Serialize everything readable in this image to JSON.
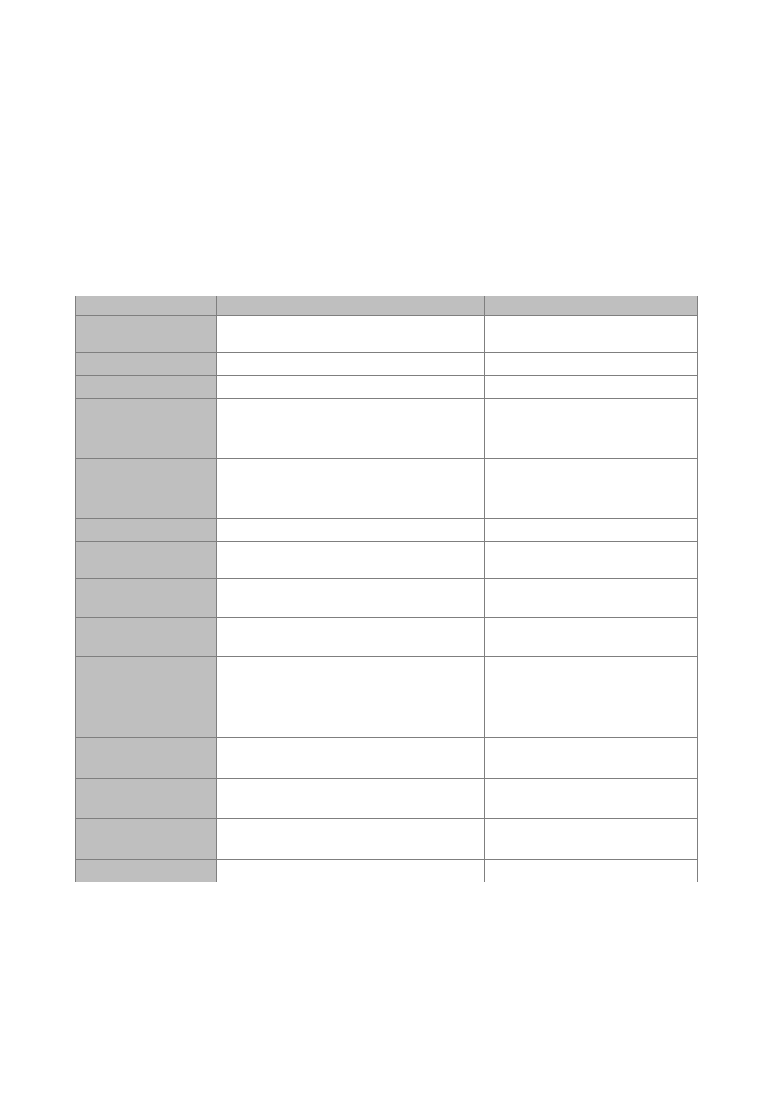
{
  "table": {
    "headers": [
      "",
      "",
      ""
    ],
    "rows": [
      {
        "height": "h-46",
        "cells": [
          "",
          "",
          ""
        ]
      },
      {
        "height": "h-28",
        "cells": [
          "",
          "",
          ""
        ]
      },
      {
        "height": "h-28",
        "cells": [
          "",
          "",
          ""
        ]
      },
      {
        "height": "h-28",
        "cells": [
          "",
          "",
          ""
        ]
      },
      {
        "height": "h-46",
        "cells": [
          "",
          "",
          ""
        ]
      },
      {
        "height": "h-28",
        "cells": [
          "",
          "",
          ""
        ]
      },
      {
        "height": "h-46",
        "cells": [
          "",
          "",
          ""
        ]
      },
      {
        "height": "h-28",
        "cells": [
          "",
          "",
          ""
        ]
      },
      {
        "height": "h-46",
        "cells": [
          "",
          "",
          ""
        ]
      },
      {
        "height": "h-24",
        "cells": [
          "",
          "",
          ""
        ]
      },
      {
        "height": "h-24",
        "cells": [
          "",
          "",
          ""
        ]
      },
      {
        "height": "h-48",
        "cells": [
          "",
          "",
          ""
        ]
      },
      {
        "height": "h-50",
        "cells": [
          "",
          "",
          ""
        ]
      },
      {
        "height": "h-50",
        "cells": [
          "",
          "",
          ""
        ]
      },
      {
        "height": "h-50",
        "cells": [
          "",
          "",
          ""
        ]
      },
      {
        "height": "h-50",
        "cells": [
          "",
          "",
          ""
        ]
      },
      {
        "height": "h-50",
        "cells": [
          "",
          "",
          ""
        ]
      },
      {
        "height": "h-28",
        "cells": [
          "",
          "",
          ""
        ]
      }
    ]
  }
}
